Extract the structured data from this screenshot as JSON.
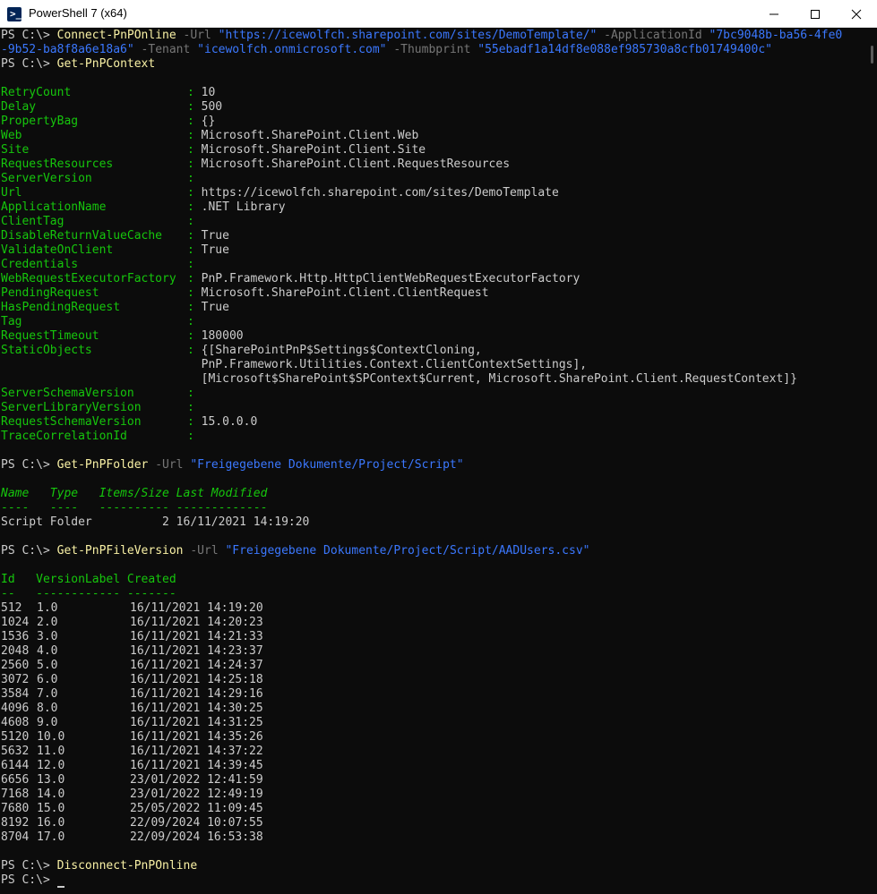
{
  "window": {
    "title": "PowerShell 7 (x64)",
    "icon_text": ">_",
    "minimize_icon": "minimize-icon",
    "maximize_icon": "maximize-icon",
    "close_icon": "close-icon"
  },
  "colors": {
    "background": "#0c0c0c",
    "foreground": "#cccccc",
    "command": "#f9f1a5",
    "parameter": "#767676",
    "string": "#3b78ff",
    "property": "#16c60c"
  },
  "prompt": "PS C:\\> ",
  "connect": {
    "line1": {
      "cmd": "Connect-PnPOnline",
      "p1": " -Url ",
      "s1": "\"https://icewolfch.sharepoint.com/sites/DemoTemplate/\"",
      "p2": " -ApplicationId ",
      "s2a": "\"7bc9048b-ba56-4fe0"
    },
    "line2": {
      "s2b": "-9b52-ba8f8a6e18a6\"",
      "p3": " -Tenant ",
      "s3": "\"icewolfch.onmicrosoft.com\"",
      "p4": " -Thumbprint ",
      "s4": "\"55ebadf1a14df8e088ef985730a8cfb01749400c\""
    }
  },
  "context_cmd": "Get-PnPContext",
  "context_props": [
    {
      "name": "RetryCount",
      "value": "10"
    },
    {
      "name": "Delay",
      "value": "500"
    },
    {
      "name": "PropertyBag",
      "value": "{}"
    },
    {
      "name": "Web",
      "value": "Microsoft.SharePoint.Client.Web"
    },
    {
      "name": "Site",
      "value": "Microsoft.SharePoint.Client.Site"
    },
    {
      "name": "RequestResources",
      "value": "Microsoft.SharePoint.Client.RequestResources"
    },
    {
      "name": "ServerVersion",
      "value": ""
    },
    {
      "name": "Url",
      "value": "https://icewolfch.sharepoint.com/sites/DemoTemplate"
    },
    {
      "name": "ApplicationName",
      "value": ".NET Library"
    },
    {
      "name": "ClientTag",
      "value": ""
    },
    {
      "name": "DisableReturnValueCache",
      "value": "True"
    },
    {
      "name": "ValidateOnClient",
      "value": "True"
    },
    {
      "name": "Credentials",
      "value": ""
    },
    {
      "name": "WebRequestExecutorFactory",
      "value": "PnP.Framework.Http.HttpClientWebRequestExecutorFactory"
    },
    {
      "name": "PendingRequest",
      "value": "Microsoft.SharePoint.Client.ClientRequest"
    },
    {
      "name": "HasPendingRequest",
      "value": "True"
    },
    {
      "name": "Tag",
      "value": ""
    },
    {
      "name": "RequestTimeout",
      "value": "180000"
    },
    {
      "name": "StaticObjects",
      "value": "{[SharePointPnP$Settings$ContextCloning,"
    },
    {
      "name": "",
      "value": "PnP.Framework.Utilities.Context.ClientContextSettings],"
    },
    {
      "name": "",
      "value": "[Microsoft$SharePoint$SPContext$Current, Microsoft.SharePoint.Client.RequestContext]}"
    },
    {
      "name": "ServerSchemaVersion",
      "value": ""
    },
    {
      "name": "ServerLibraryVersion",
      "value": ""
    },
    {
      "name": "RequestSchemaVersion",
      "value": "15.0.0.0"
    },
    {
      "name": "TraceCorrelationId",
      "value": ""
    }
  ],
  "folder": {
    "cmd": "Get-PnPFolder",
    "param": " -Url ",
    "arg": "\"Freigegebene Dokumente/Project/Script\"",
    "header": "Name   Type   Items/Size Last Modified",
    "underline": "----   ----   ---------- -------------",
    "row": "Script Folder          2 16/11/2021 14:19:20"
  },
  "versions": {
    "cmd": "Get-PnPFileVersion",
    "param": " -Url ",
    "arg": "\"Freigegebene Dokumente/Project/Script/AADUsers.csv\"",
    "header": "Id   VersionLabel Created",
    "underline": "--   ------------ -------",
    "rows": [
      {
        "id": "512",
        "label": "1.0",
        "created": "16/11/2021 14:19:20"
      },
      {
        "id": "1024",
        "label": "2.0",
        "created": "16/11/2021 14:20:23"
      },
      {
        "id": "1536",
        "label": "3.0",
        "created": "16/11/2021 14:21:33"
      },
      {
        "id": "2048",
        "label": "4.0",
        "created": "16/11/2021 14:23:37"
      },
      {
        "id": "2560",
        "label": "5.0",
        "created": "16/11/2021 14:24:37"
      },
      {
        "id": "3072",
        "label": "6.0",
        "created": "16/11/2021 14:25:18"
      },
      {
        "id": "3584",
        "label": "7.0",
        "created": "16/11/2021 14:29:16"
      },
      {
        "id": "4096",
        "label": "8.0",
        "created": "16/11/2021 14:30:25"
      },
      {
        "id": "4608",
        "label": "9.0",
        "created": "16/11/2021 14:31:25"
      },
      {
        "id": "5120",
        "label": "10.0",
        "created": "16/11/2021 14:35:26"
      },
      {
        "id": "5632",
        "label": "11.0",
        "created": "16/11/2021 14:37:22"
      },
      {
        "id": "6144",
        "label": "12.0",
        "created": "16/11/2021 14:39:45"
      },
      {
        "id": "6656",
        "label": "13.0",
        "created": "23/01/2022 12:41:59"
      },
      {
        "id": "7168",
        "label": "14.0",
        "created": "23/01/2022 12:49:19"
      },
      {
        "id": "7680",
        "label": "15.0",
        "created": "25/05/2022 11:09:45"
      },
      {
        "id": "8192",
        "label": "16.0",
        "created": "22/09/2024 10:07:55"
      },
      {
        "id": "8704",
        "label": "17.0",
        "created": "22/09/2024 16:53:38"
      }
    ]
  },
  "disconnect_cmd": "Disconnect-PnPOnline"
}
